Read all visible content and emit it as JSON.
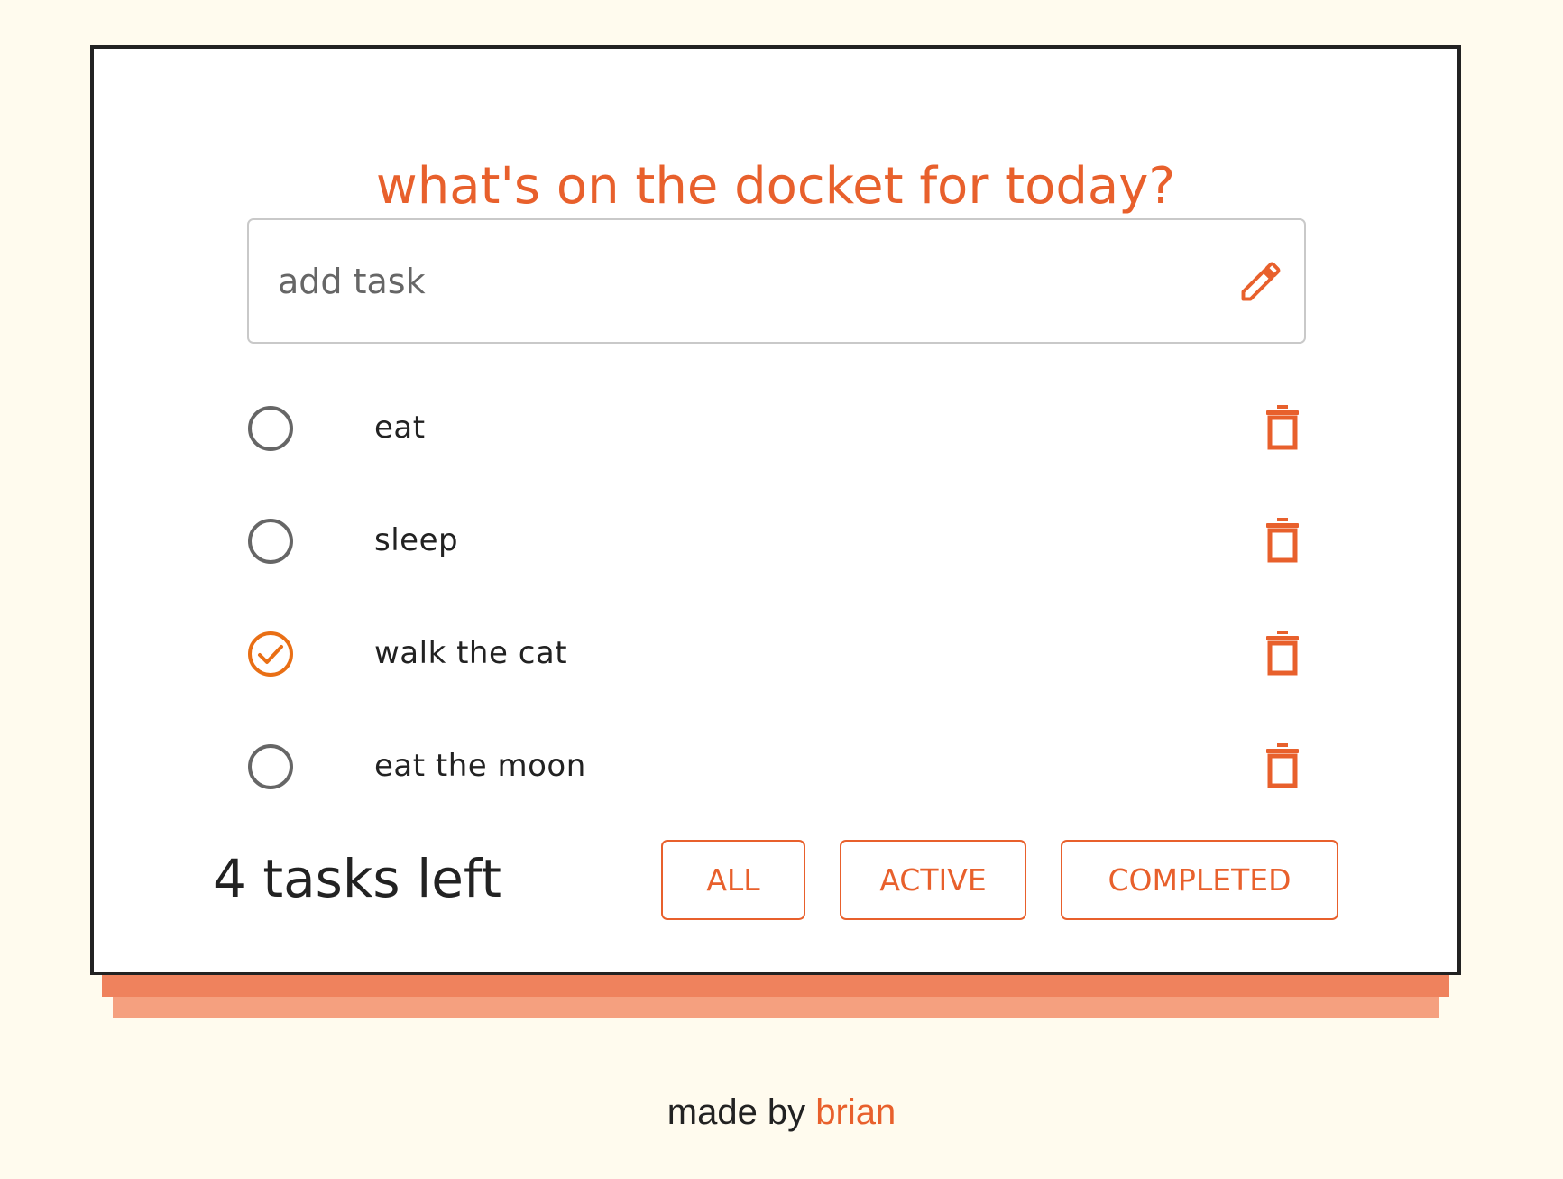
{
  "header": {
    "title": "what's on the docket for today?"
  },
  "add_task": {
    "placeholder": "add task",
    "value": "",
    "icon": "pencil-icon"
  },
  "tasks": [
    {
      "label": "eat",
      "completed": false
    },
    {
      "label": "sleep",
      "completed": false
    },
    {
      "label": "walk the cat",
      "completed": true
    },
    {
      "label": "eat the moon",
      "completed": false
    }
  ],
  "footer_bar": {
    "count_text": "4 tasks left",
    "filters": [
      "ALL",
      "ACTIVE",
      "COMPLETED"
    ]
  },
  "credit": {
    "prefix": "made by",
    "author": "brian"
  },
  "colors": {
    "accent": "#e8602c",
    "background": "#fffbee",
    "unchecked": "#666666"
  }
}
